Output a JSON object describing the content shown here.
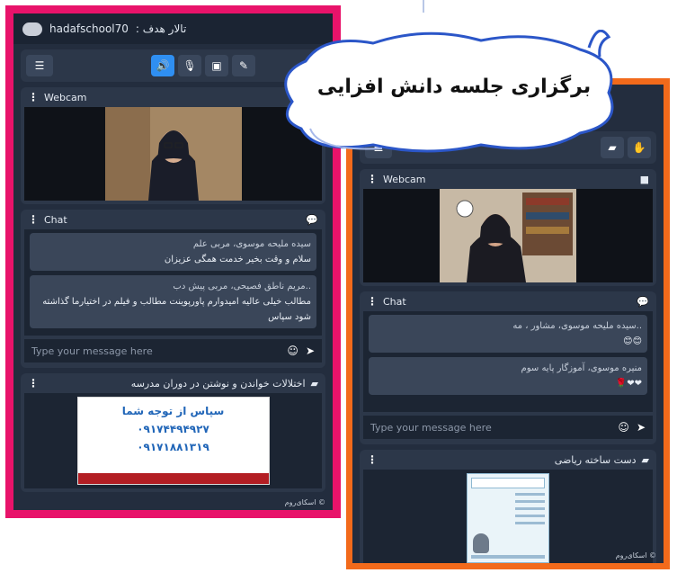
{
  "banner": {
    "title": "برگزاری جلسه دانش افزایی"
  },
  "left_window": {
    "user": "hadafschool70",
    "room_title": "تالار هدف :",
    "webcam_label": "Webcam",
    "chat_label": "Chat",
    "chat_messages": [
      {
        "author": "سیده مليحه موسوی، مربی علم",
        "text": "سلام و وقت بخیر  خدمت همگی عزیزان"
      },
      {
        "author": "..مریم ناطق فصیحی، مربی پیش دب",
        "text": "مطالب خیلی عالیه امیدوارم پاورپوینت مطالب و فیلم در اختیارما گذاشته شود سپاس"
      }
    ],
    "chat_placeholder": "Type your message here",
    "doc_title": "اختلالات خواندن و نوشتن در دوران مدرسه",
    "doc_lines": [
      "سپاس از توجه شما",
      "۰۹۱۷۴۴۹۴۹۲۷",
      "۰۹۱۷۱۸۸۱۳۱۹"
    ],
    "brand": "اسکای‌روم ©"
  },
  "right_window": {
    "webcam_label": "Webcam",
    "chat_label": "Chat",
    "chat_messages": [
      {
        "author": "..سیده مليحه موسوی، مشاور ، مه",
        "text": "😊😊"
      },
      {
        "author": "منیره موسوی، آموزگار پایه سوم",
        "text": "❤❤🌹"
      }
    ],
    "chat_placeholder": "Type your message here",
    "doc_title": "دست ساخته ریاضی",
    "brand": "اسکای‌روم ©"
  },
  "colors": {
    "frame_left": "#e8136a",
    "frame_right": "#f26a1b",
    "app_bg": "#232d3e",
    "active_button": "#2f8ff2"
  }
}
